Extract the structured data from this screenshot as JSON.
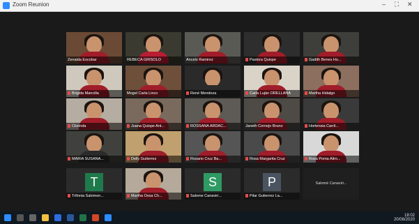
{
  "window": {
    "title": "Zoom Reunion",
    "minimize": "–",
    "maximize": "⛶",
    "close": "✕"
  },
  "participants": [
    {
      "name": "Zenaida Escobar",
      "mute": false,
      "shirt": "#a11d2a",
      "bg": "#6a4a35"
    },
    {
      "name": "REBECA GRISOLO",
      "mute": false,
      "shirt": "#b91d33",
      "bg": "#3a3a30",
      "highlight": true
    },
    {
      "name": "Ancelo Ramirez",
      "mute": false,
      "shirt": "#a11d2a",
      "bg": "#5a5a55"
    },
    {
      "name": "Pastora Quispe",
      "mute": true,
      "shirt": "#a11d2a",
      "bg": "#2e2e2e"
    },
    {
      "name": "Gadith Benes Ho...",
      "mute": true,
      "shirt": "#a11d2a",
      "bg": "#3e3e3a"
    },
    {
      "name": "Brigida Mancilla",
      "mute": true,
      "shirt": "#a11d2a",
      "bg": "#cfc9bd"
    },
    {
      "name": "Mogel Carla Linco",
      "mute": false,
      "shirt": "#a11d2a",
      "bg": "#6e4f3a"
    },
    {
      "name": "René Mendoza",
      "mute": true,
      "shirt": "#2b2b2b",
      "bg": "#2a2a2a"
    },
    {
      "name": "Carla Luján ORELLANA",
      "mute": true,
      "shirt": "#a11d2a",
      "bg": "#d9d3c8"
    },
    {
      "name": "Martha Hidalgo",
      "mute": true,
      "shirt": "#a11d2a",
      "bg": "#8c6f5e"
    },
    {
      "name": "Clorinda",
      "mute": true,
      "shirt": "#a11d2a",
      "bg": "#b5aca2"
    },
    {
      "name": "Juana Quispe Ant...",
      "mute": true,
      "shirt": "#a11d2a",
      "bg": "#7a6a5d"
    },
    {
      "name": "ROSSANA ARDAC...",
      "mute": true,
      "shirt": "#a11d2a",
      "bg": "#5e5a55"
    },
    {
      "name": "Janeth Cornejo Bruno",
      "mute": false,
      "shirt": "#a11d2a",
      "bg": "#4e4a45"
    },
    {
      "name": "Hortensia Carril...",
      "mute": true,
      "shirt": "#a11d2a",
      "bg": "#3a3a3a"
    },
    {
      "name": "MARIA SUSANA...",
      "mute": true,
      "shirt": "#2b2b2b",
      "bg": "#40403c"
    },
    {
      "name": "Delly Gutierrez",
      "mute": true,
      "shirt": "#a11d2a",
      "bg": "#bfa06e"
    },
    {
      "name": "Rosario Cruz Ba...",
      "mute": true,
      "shirt": "#a11d2a",
      "bg": "#555"
    },
    {
      "name": "Rosa Margarita Cruz",
      "mute": true,
      "shirt": "#a11d2a",
      "bg": "#4a4a4a"
    },
    {
      "name": "Rosa Poma Aliro...",
      "mute": true,
      "shirt": "#a11d2a",
      "bg": "#d8d8d8"
    },
    {
      "name": "Trifonia Salomon...",
      "mute": true,
      "letter": "T",
      "letter_bg": "#1f7a4b"
    },
    {
      "name": "Martha Ossa Ch...",
      "mute": true,
      "shirt": "#a11d2a",
      "bg": "#b4a99a"
    },
    {
      "name": "Salome Canaviri...",
      "mute": true,
      "letter": "S",
      "letter_bg": "#2f9a63"
    },
    {
      "name": "Pilar Gutierrez La...",
      "mute": true,
      "letter": "P",
      "letter_bg": "#4a5460"
    },
    {
      "name": "Salomé Canaviri...",
      "mute": true,
      "plain": true
    }
  ],
  "taskbar": {
    "time": "18:02",
    "date": "20/08/2020"
  }
}
